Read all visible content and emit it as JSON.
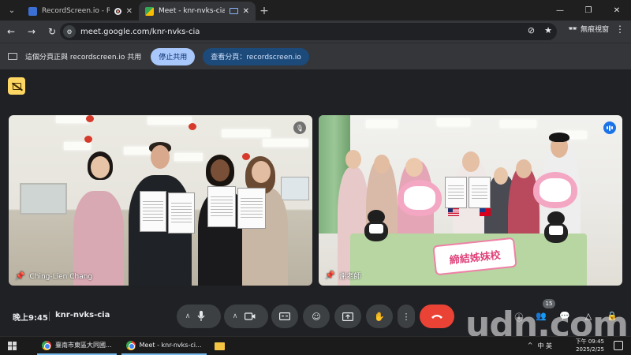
{
  "browser": {
    "tab_list_icon": "chevron-down-icon",
    "tabs": [
      {
        "title": "RecordScreen.io - Record",
        "favicon_color": "#3b6fd4",
        "active": false
      },
      {
        "title": "Meet - knr-nvks-cia",
        "favicon_color": "#34a853",
        "active": true
      }
    ],
    "new_tab_label": "+",
    "window_controls": {
      "minimize": "—",
      "maximize": "❐",
      "close": "✕"
    },
    "url": "meet.google.com/knr-nvks-cia",
    "incognito_label": "無痕視窗"
  },
  "share_bar": {
    "text": "這個分頁正與 recordscreen.io 共用",
    "stop_label": "停止共用",
    "view_label": "查看分頁：recordscreen.io"
  },
  "meet": {
    "tiles": [
      {
        "name": "Ching-Lien Chang",
        "mic_muted": true
      },
      {
        "name": "謝老師",
        "speaking": true,
        "banner_text": "締結姊妹校"
      }
    ],
    "time": "晚上9:45",
    "meeting_code": "knr-nvks-cia",
    "participant_count": "15",
    "end_call_color": "#ea4335"
  },
  "watermark": "udn.com",
  "taskbar": {
    "apps": [
      {
        "label": "臺南市東區大同國..."
      },
      {
        "label": "Meet - knr-nvks-ci..."
      }
    ],
    "tray_lang": "中 英",
    "clock_time": "下午 09:45",
    "clock_date": "2025/2/25"
  }
}
